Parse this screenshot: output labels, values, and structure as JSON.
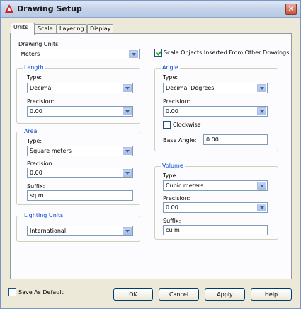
{
  "window": {
    "title": "Drawing Setup",
    "close_glyph": "✕"
  },
  "tabs": [
    {
      "label": "Units",
      "active": true
    },
    {
      "label": "Scale",
      "active": false
    },
    {
      "label": "Layering",
      "active": false
    },
    {
      "label": "Display",
      "active": false
    }
  ],
  "units": {
    "drawing_units": {
      "label": "Drawing Units:",
      "value": "Meters"
    },
    "scale_objects": {
      "label": "Scale Objects Inserted From Other Drawings",
      "checked": true
    },
    "length": {
      "title": "Length",
      "type_label": "Type:",
      "type_value": "Decimal",
      "precision_label": "Precision:",
      "precision_value": "0.00"
    },
    "angle": {
      "title": "Angle",
      "type_label": "Type:",
      "type_value": "Decimal Degrees",
      "precision_label": "Precision:",
      "precision_value": "0.00",
      "clockwise_label": "Clockwise",
      "clockwise_checked": false,
      "base_angle_label": "Base Angle:",
      "base_angle_value": "0.00"
    },
    "area": {
      "title": "Area",
      "type_label": "Type:",
      "type_value": "Square meters",
      "precision_label": "Precision:",
      "precision_value": "0.00",
      "suffix_label": "Suffix:",
      "suffix_value": "sq m"
    },
    "volume": {
      "title": "Volume",
      "type_label": "Type:",
      "type_value": "Cubic meters",
      "precision_label": "Precision:",
      "precision_value": "0.00",
      "suffix_label": "Suffix:",
      "suffix_value": "cu m"
    },
    "lighting": {
      "title": "Lighting Units",
      "value": "International"
    }
  },
  "footer": {
    "save_default_label": "Save As Default",
    "save_default_checked": false,
    "ok": "OK",
    "cancel": "Cancel",
    "apply": "Apply",
    "help": "Help"
  },
  "colors": {
    "group_title": "#0046d5",
    "checkbox_check": "#21a121",
    "title_bar": "#c4d3ea"
  }
}
